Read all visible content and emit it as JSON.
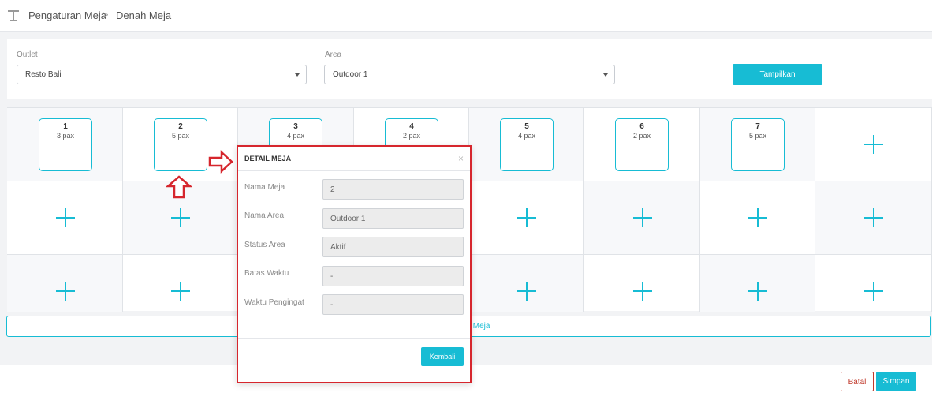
{
  "breadcrumb": {
    "icon": "desk-icon",
    "items": [
      "Pengaturan Meja",
      "Denah Meja"
    ],
    "separator": ">"
  },
  "filter": {
    "outlet": {
      "label": "Outlet",
      "value": "Resto Bali"
    },
    "area": {
      "label": "Area",
      "value": "Outdoor 1"
    },
    "show_button": "Tampilkan"
  },
  "tables": [
    {
      "number": "1",
      "pax": "3 pax"
    },
    {
      "number": "2",
      "pax": "5 pax"
    },
    {
      "number": "3",
      "pax": "4 pax"
    },
    {
      "number": "4",
      "pax": "2 pax"
    },
    {
      "number": "5",
      "pax": "4 pax"
    },
    {
      "number": "6",
      "pax": "2 pax"
    },
    {
      "number": "7",
      "pax": "5 pax"
    }
  ],
  "denah_button": "Denah Meja",
  "footer": {
    "cancel": "Batal",
    "save": "Simpan"
  },
  "modal": {
    "title": "DETAIL MEJA",
    "close": "×",
    "fields": [
      {
        "label": "Nama Meja",
        "value": "2"
      },
      {
        "label": "Nama Area",
        "value": "Outdoor 1"
      },
      {
        "label": "Status Area",
        "value": "Aktif"
      },
      {
        "label": "Batas Waktu",
        "value": "-"
      },
      {
        "label": "Waktu Pengingat",
        "value": "-"
      }
    ],
    "back_button": "Kembali"
  },
  "colors": {
    "accent": "#17bcd4",
    "annotation": "#d6262d",
    "danger": "#c0392b"
  }
}
